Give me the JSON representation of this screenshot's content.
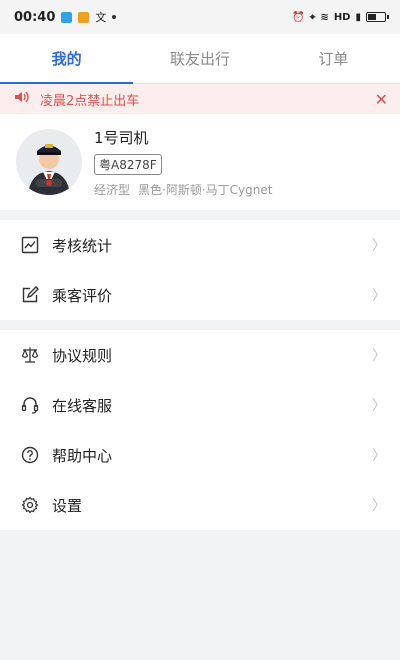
{
  "status_bar": {
    "time": "00:40",
    "network": "HD"
  },
  "tabs": [
    {
      "label": "我的",
      "active": true
    },
    {
      "label": "联友出行",
      "active": false
    },
    {
      "label": "订单",
      "active": false
    }
  ],
  "notice": {
    "text": "凌晨2点禁止出车"
  },
  "profile": {
    "name": "1号司机",
    "plate": "粤A8278F",
    "car_class": "经济型",
    "car_desc": "黑色·阿斯顿·马丁Cygnet"
  },
  "menu_group_1": [
    {
      "label": "考核统计",
      "icon": "chart-icon"
    },
    {
      "label": "乘客评价",
      "icon": "edit-icon"
    }
  ],
  "menu_group_2": [
    {
      "label": "协议规则",
      "icon": "scale-icon"
    },
    {
      "label": "在线客服",
      "icon": "headset-icon"
    },
    {
      "label": "帮助中心",
      "icon": "help-icon"
    },
    {
      "label": "设置",
      "icon": "gear-icon"
    }
  ],
  "colors": {
    "accent": "#2c6bd6",
    "notice_bg": "#fdeeee",
    "notice_text": "#d9534f"
  }
}
